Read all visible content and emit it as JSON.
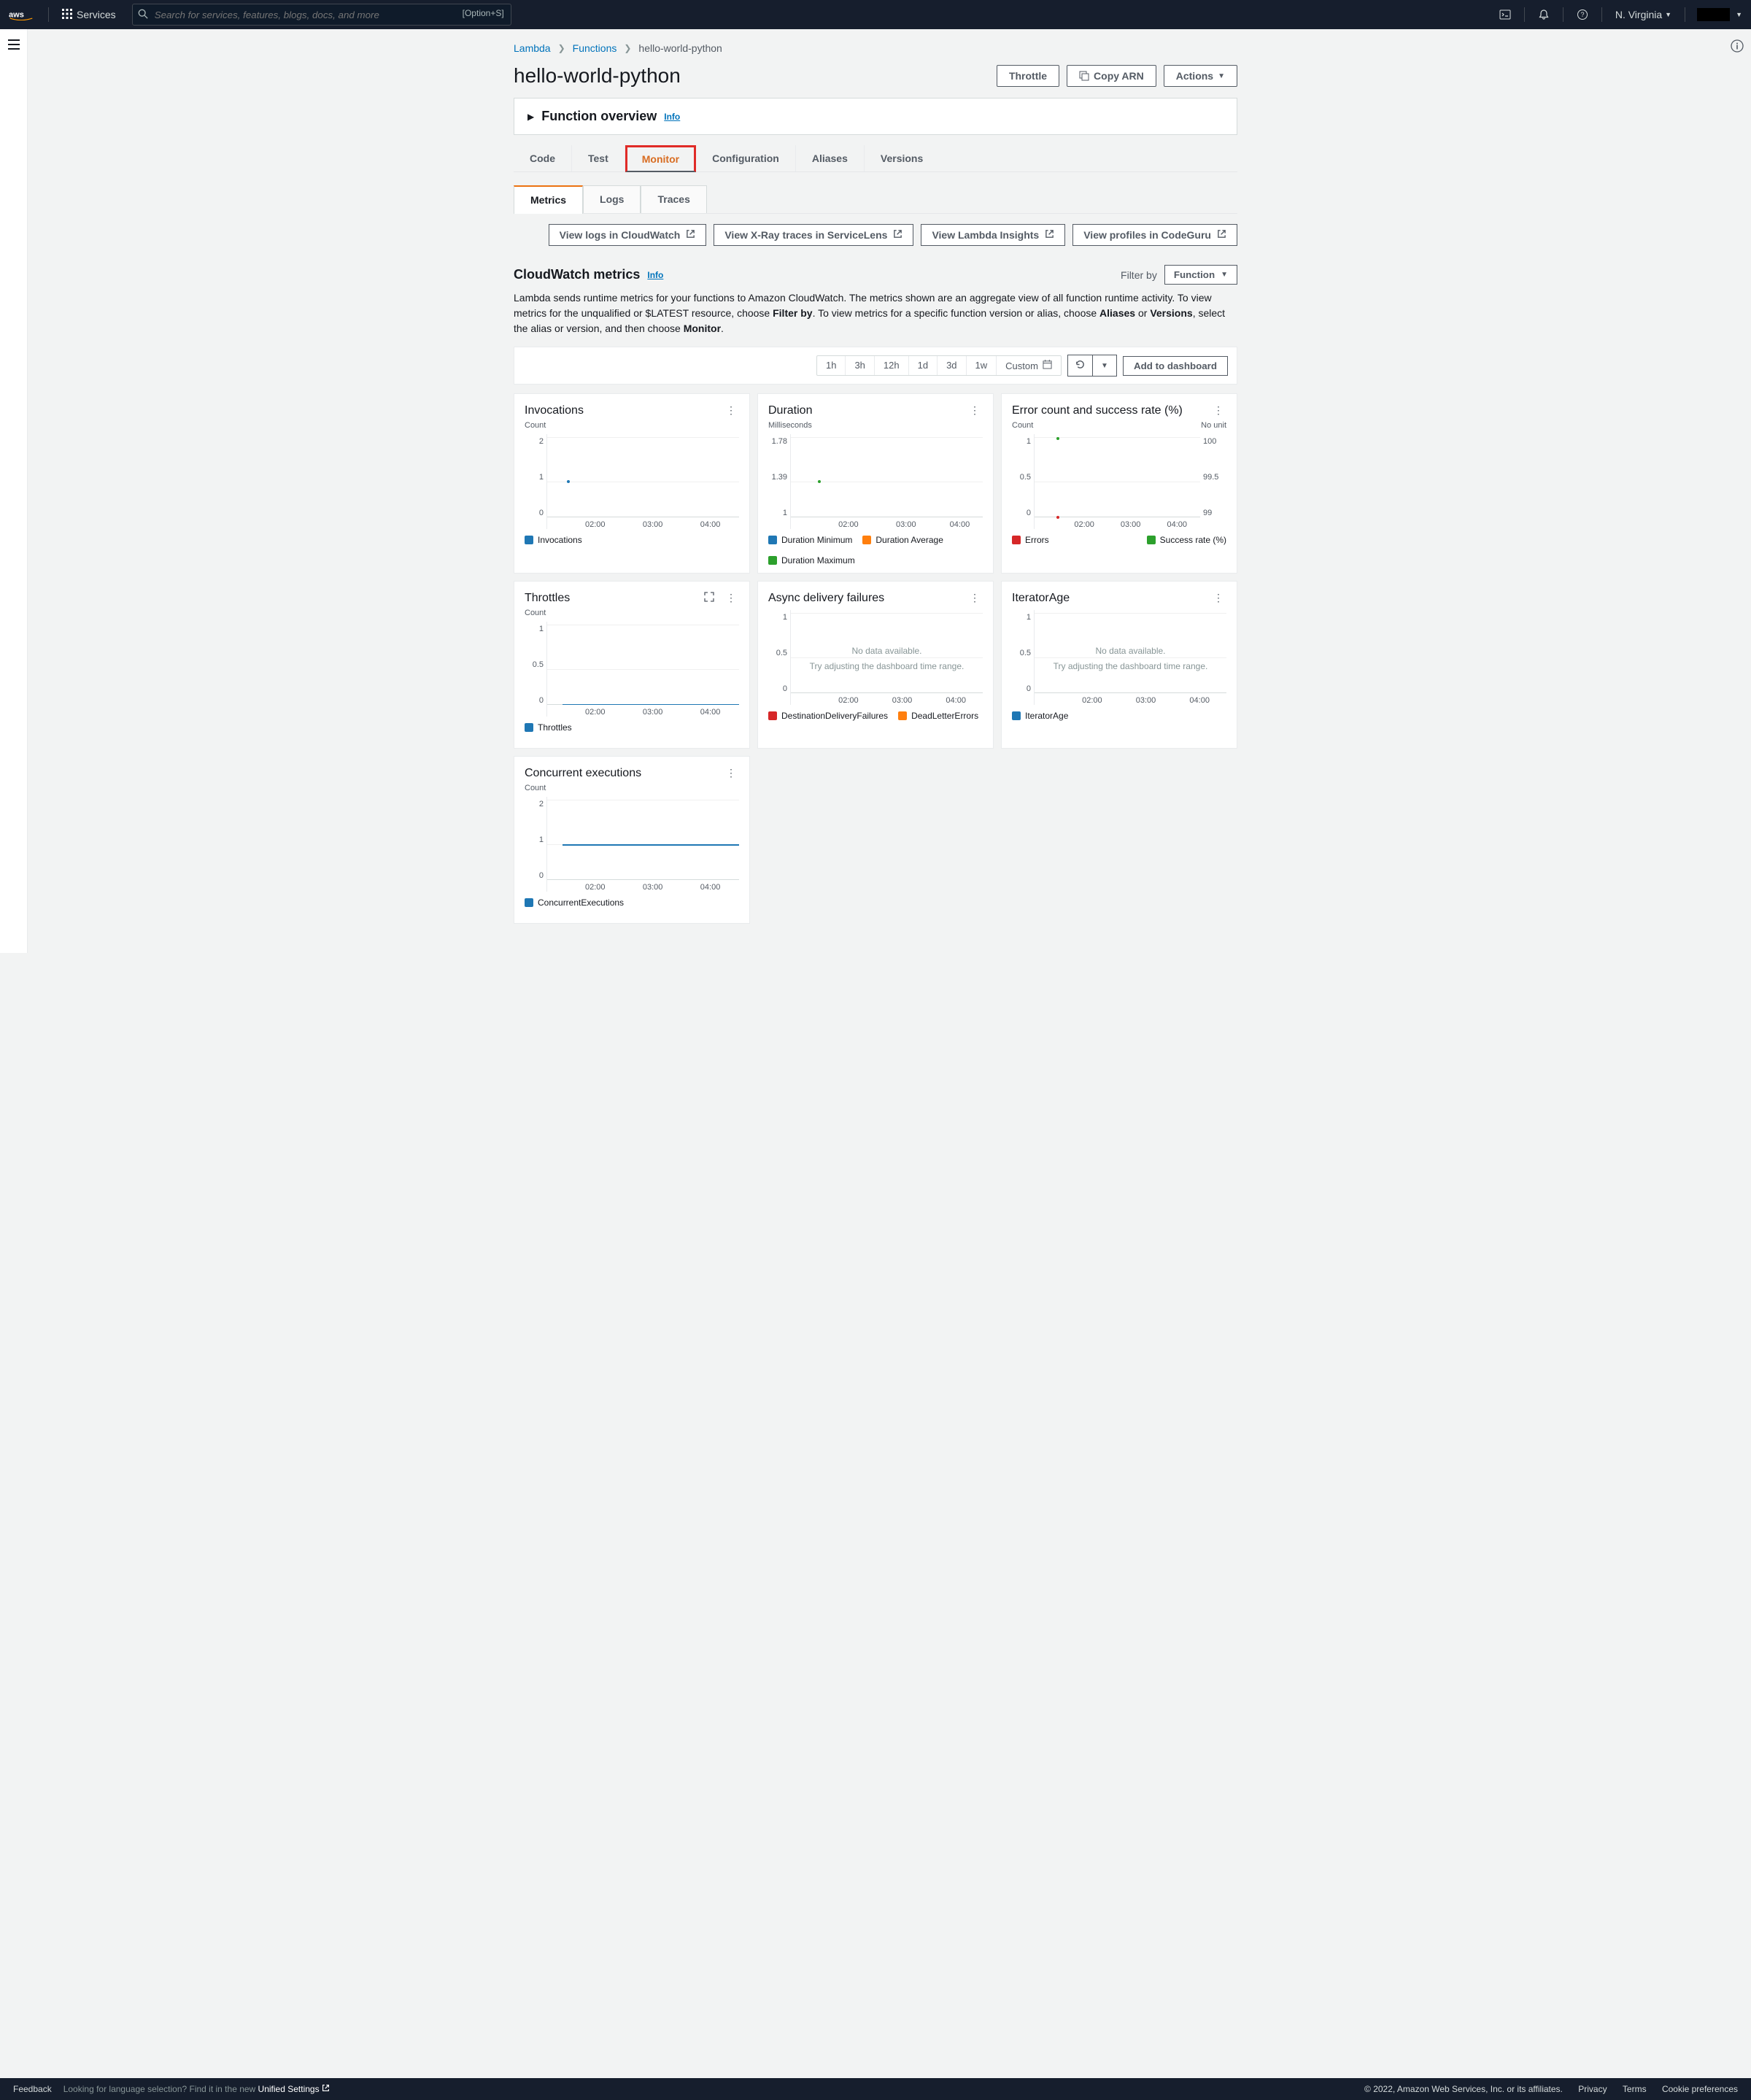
{
  "topnav": {
    "services": "Services",
    "search_placeholder": "Search for services, features, blogs, docs, and more",
    "shortcut": "[Option+S]",
    "region": "N. Virginia"
  },
  "breadcrumbs": {
    "root": "Lambda",
    "section": "Functions",
    "current": "hello-world-python"
  },
  "page_title": "hello-world-python",
  "title_buttons": {
    "throttle": "Throttle",
    "copy_arn": "Copy ARN",
    "actions": "Actions"
  },
  "overview": {
    "title": "Function overview",
    "info": "Info"
  },
  "tabs": {
    "code": "Code",
    "test": "Test",
    "monitor": "Monitor",
    "configuration": "Configuration",
    "aliases": "Aliases",
    "versions": "Versions"
  },
  "subtabs": {
    "metrics": "Metrics",
    "logs": "Logs",
    "traces": "Traces"
  },
  "ext_buttons": {
    "cloudwatch": "View logs in CloudWatch",
    "xray": "View X-Ray traces in ServiceLens",
    "insights": "View Lambda Insights",
    "codeguru": "View profiles in CodeGuru"
  },
  "cw_section": {
    "title": "CloudWatch metrics",
    "info": "Info",
    "filter_label": "Filter by",
    "filter_value": "Function",
    "desc_p1": "Lambda sends runtime metrics for your functions to Amazon CloudWatch. The metrics shown are an aggregate view of all function runtime activity. To view metrics for the unqualified or $LATEST resource, choose ",
    "desc_b1": "Filter by",
    "desc_p2": ". To view metrics for a specific function version or alias, choose ",
    "desc_b2": "Aliases",
    "desc_p3": " or ",
    "desc_b3": "Versions",
    "desc_p4": ", select the alias or version, and then choose ",
    "desc_b4": "Monitor",
    "desc_p5": "."
  },
  "time_ranges": [
    "1h",
    "3h",
    "12h",
    "1d",
    "3d",
    "1w"
  ],
  "custom_label": "Custom",
  "add_dashboard": "Add to dashboard",
  "cards": {
    "invocations": {
      "title": "Invocations",
      "unit_left": "Count",
      "yticks": [
        "2",
        "1",
        "0"
      ],
      "xticks": [
        "02:00",
        "03:00",
        "04:00"
      ],
      "legend": [
        {
          "label": "Invocations",
          "color": "#1f77b4"
        }
      ]
    },
    "duration": {
      "title": "Duration",
      "unit_left": "Milliseconds",
      "yticks": [
        "1.78",
        "1.39",
        "1"
      ],
      "xticks": [
        "02:00",
        "03:00",
        "04:00"
      ],
      "legend": [
        {
          "label": "Duration Minimum",
          "color": "#1f77b4"
        },
        {
          "label": "Duration Average",
          "color": "#ff7f0e"
        },
        {
          "label": "Duration Maximum",
          "color": "#2ca02c"
        }
      ]
    },
    "error": {
      "title": "Error count and success rate (%)",
      "unit_left": "Count",
      "unit_right": "No unit",
      "yticks_left": [
        "1",
        "0.5",
        "0"
      ],
      "yticks_right": [
        "100",
        "99.5",
        "99"
      ],
      "xticks": [
        "02:00",
        "03:00",
        "04:00"
      ],
      "legend_left": {
        "label": "Errors",
        "color": "#d62728"
      },
      "legend_right": {
        "label": "Success rate (%)",
        "color": "#2ca02c"
      }
    },
    "throttles": {
      "title": "Throttles",
      "unit_left": "Count",
      "yticks": [
        "1",
        "0.5",
        "0"
      ],
      "xticks": [
        "02:00",
        "03:00",
        "04:00"
      ],
      "legend": [
        {
          "label": "Throttles",
          "color": "#1f77b4"
        }
      ]
    },
    "async": {
      "title": "Async delivery failures",
      "yticks": [
        "1",
        "0.5",
        "0"
      ],
      "xticks": [
        "02:00",
        "03:00",
        "04:00"
      ],
      "nodata_1": "No data available.",
      "nodata_2": "Try adjusting the dashboard time range.",
      "legend": [
        {
          "label": "DestinationDeliveryFailures",
          "color": "#d62728"
        },
        {
          "label": "DeadLetterErrors",
          "color": "#ff7f0e"
        }
      ]
    },
    "iterator": {
      "title": "IteratorAge",
      "yticks": [
        "1",
        "0.5",
        "0"
      ],
      "xticks": [
        "02:00",
        "03:00",
        "04:00"
      ],
      "nodata_1": "No data available.",
      "nodata_2": "Try adjusting the dashboard time range.",
      "legend": [
        {
          "label": "IteratorAge",
          "color": "#1f77b4"
        }
      ]
    },
    "concurrent": {
      "title": "Concurrent executions",
      "unit_left": "Count",
      "yticks": [
        "2",
        "1",
        "0"
      ],
      "xticks": [
        "02:00",
        "03:00",
        "04:00"
      ],
      "legend": [
        {
          "label": "ConcurrentExecutions",
          "color": "#1f77b4"
        }
      ]
    }
  },
  "chart_data": [
    {
      "type": "line",
      "title": "Invocations",
      "ylabel": "Count",
      "categories": [
        "02:00",
        "03:00",
        "04:00"
      ],
      "series": [
        {
          "name": "Invocations",
          "values": [
            1,
            null,
            null
          ]
        }
      ],
      "ylim": [
        0,
        2
      ]
    },
    {
      "type": "line",
      "title": "Duration",
      "ylabel": "Milliseconds",
      "categories": [
        "02:00",
        "03:00",
        "04:00"
      ],
      "series": [
        {
          "name": "Duration Minimum",
          "values": [
            1.39,
            null,
            null
          ]
        },
        {
          "name": "Duration Average",
          "values": [
            1.39,
            null,
            null
          ]
        },
        {
          "name": "Duration Maximum",
          "values": [
            1.39,
            null,
            null
          ]
        }
      ],
      "ylim": [
        1,
        1.78
      ]
    },
    {
      "type": "line",
      "title": "Error count and success rate (%)",
      "ylabel": "Count",
      "y2label": "No unit",
      "categories": [
        "02:00",
        "03:00",
        "04:00"
      ],
      "series": [
        {
          "name": "Errors",
          "axis": "left",
          "values": [
            0,
            null,
            null
          ]
        },
        {
          "name": "Success rate (%)",
          "axis": "right",
          "values": [
            100,
            null,
            null
          ]
        }
      ],
      "ylim": [
        0,
        1
      ],
      "y2lim": [
        99,
        100
      ]
    },
    {
      "type": "line",
      "title": "Throttles",
      "ylabel": "Count",
      "categories": [
        "02:00",
        "03:00",
        "04:00"
      ],
      "series": [
        {
          "name": "Throttles",
          "values": [
            0,
            0,
            0
          ]
        }
      ],
      "ylim": [
        0,
        1
      ]
    },
    {
      "type": "line",
      "title": "Async delivery failures",
      "categories": [
        "02:00",
        "03:00",
        "04:00"
      ],
      "series": [
        {
          "name": "DestinationDeliveryFailures",
          "values": []
        },
        {
          "name": "DeadLetterErrors",
          "values": []
        }
      ],
      "ylim": [
        0,
        1
      ],
      "note": "No data available."
    },
    {
      "type": "line",
      "title": "IteratorAge",
      "categories": [
        "02:00",
        "03:00",
        "04:00"
      ],
      "series": [
        {
          "name": "IteratorAge",
          "values": []
        }
      ],
      "ylim": [
        0,
        1
      ],
      "note": "No data available."
    },
    {
      "type": "line",
      "title": "Concurrent executions",
      "ylabel": "Count",
      "categories": [
        "02:00",
        "03:00",
        "04:00"
      ],
      "series": [
        {
          "name": "ConcurrentExecutions",
          "values": [
            1,
            1,
            1
          ]
        }
      ],
      "ylim": [
        0,
        2
      ]
    }
  ],
  "footer": {
    "feedback": "Feedback",
    "lang_hint_1": "Looking for language selection? Find it in the new ",
    "lang_hint_2": "Unified Settings",
    "copyright": "© 2022, Amazon Web Services, Inc. or its affiliates.",
    "privacy": "Privacy",
    "terms": "Terms",
    "cookie": "Cookie preferences"
  }
}
